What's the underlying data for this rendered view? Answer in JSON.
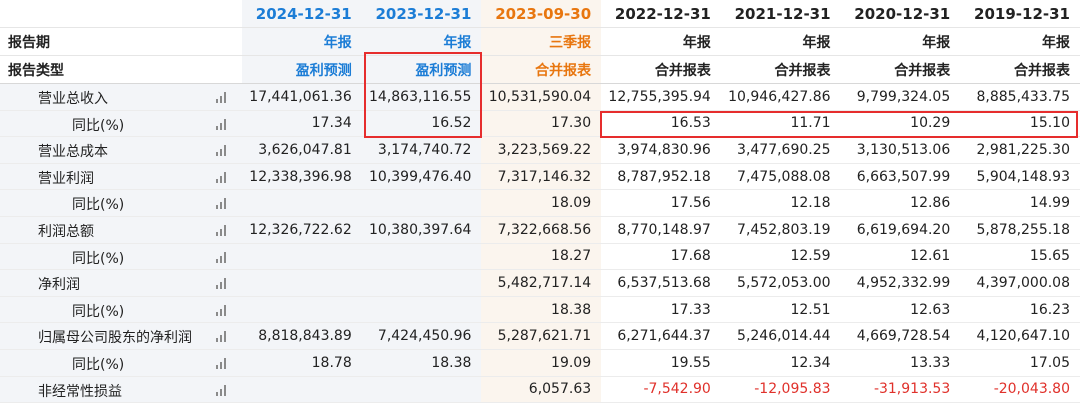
{
  "header": {
    "period_label": "报告期",
    "type_label": "报告类型",
    "columns": [
      {
        "date": "2024-12-31",
        "period": "年报",
        "type": "盈利预测"
      },
      {
        "date": "2023-12-31",
        "period": "年报",
        "type": "盈利预测"
      },
      {
        "date": "2023-09-30",
        "period": "三季报",
        "type": "合并报表"
      },
      {
        "date": "2022-12-31",
        "period": "年报",
        "type": "合并报表"
      },
      {
        "date": "2021-12-31",
        "period": "年报",
        "type": "合并报表"
      },
      {
        "date": "2020-12-31",
        "period": "年报",
        "type": "合并报表"
      },
      {
        "date": "2019-12-31",
        "period": "年报",
        "type": "合并报表"
      }
    ]
  },
  "colors": {
    "forecast": "#1c7dd6",
    "quarter": "#e8760f",
    "negative": "#e0312b",
    "highlight": "#e62d2d"
  },
  "rows": [
    {
      "label": "营业总收入",
      "icon": "bar-chart-icon",
      "values": [
        "17,441,061.36",
        "14,863,116.55",
        "10,531,590.04",
        "12,755,395.94",
        "10,946,427.86",
        "9,799,324.05",
        "8,885,433.75"
      ]
    },
    {
      "label": "同比(%)",
      "icon": "bar-chart-icon",
      "values": [
        "17.34",
        "16.52",
        "17.30",
        "16.53",
        "11.71",
        "10.29",
        "15.10"
      ]
    },
    {
      "label": "营业总成本",
      "icon": "bar-chart-icon",
      "values": [
        "3,626,047.81",
        "3,174,740.72",
        "3,223,569.22",
        "3,974,830.96",
        "3,477,690.25",
        "3,130,513.06",
        "2,981,225.30"
      ]
    },
    {
      "label": "营业利润",
      "icon": "bar-chart-icon",
      "values": [
        "12,338,396.98",
        "10,399,476.40",
        "7,317,146.32",
        "8,787,952.18",
        "7,475,088.08",
        "6,663,507.99",
        "5,904,148.93"
      ]
    },
    {
      "label": "同比(%)",
      "icon": "bar-chart-icon",
      "values": [
        "",
        "",
        "18.09",
        "17.56",
        "12.18",
        "12.86",
        "14.99"
      ]
    },
    {
      "label": "利润总额",
      "icon": "bar-chart-icon",
      "values": [
        "12,326,722.62",
        "10,380,397.64",
        "7,322,668.56",
        "8,770,148.97",
        "7,452,803.19",
        "6,619,694.20",
        "5,878,255.18"
      ]
    },
    {
      "label": "同比(%)",
      "icon": "bar-chart-icon",
      "values": [
        "",
        "",
        "18.27",
        "17.68",
        "12.59",
        "12.61",
        "15.65"
      ]
    },
    {
      "label": "净利润",
      "icon": "bar-chart-icon",
      "values": [
        "",
        "",
        "5,482,717.14",
        "6,537,513.68",
        "5,572,053.00",
        "4,952,332.99",
        "4,397,000.08"
      ]
    },
    {
      "label": "同比(%)",
      "icon": "bar-chart-icon",
      "values": [
        "",
        "",
        "18.38",
        "17.33",
        "12.51",
        "12.63",
        "16.23"
      ]
    },
    {
      "label": "归属母公司股东的净利润",
      "icon": "bar-chart-icon",
      "values": [
        "8,818,843.89",
        "7,424,450.96",
        "5,287,621.71",
        "6,271,644.37",
        "5,246,014.44",
        "4,669,728.54",
        "4,120,647.10"
      ]
    },
    {
      "label": "同比(%)",
      "icon": "bar-chart-icon",
      "values": [
        "18.78",
        "18.38",
        "19.09",
        "19.55",
        "12.34",
        "13.33",
        "17.05"
      ]
    },
    {
      "label": "非经常性损益",
      "icon": "bar-chart-icon",
      "values": [
        "",
        "",
        "6,057.63",
        "-7,542.90",
        "-12,095.83",
        "-31,913.53",
        "-20,043.80"
      ]
    }
  ]
}
